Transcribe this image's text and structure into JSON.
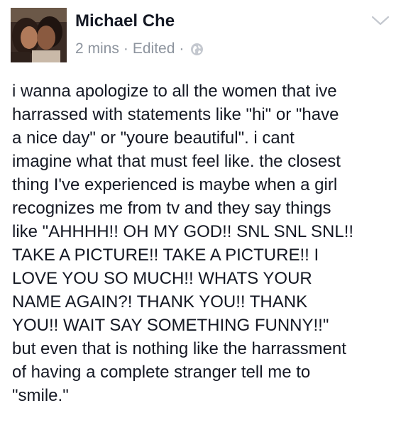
{
  "post": {
    "author": "Michael Che",
    "time": "2 mins",
    "dot1": "·",
    "edited": "Edited",
    "dot2": "·",
    "privacy_icon": "globe-icon",
    "menu_icon": "chevron-down-icon",
    "avatar_icon": "profile-photo",
    "text": "i wanna apologize to all the women that ive\nharrassed with statements like \"hi\" or \"have\na nice day\" or \"youre beautiful\". i cant\nimagine what that must feel like. the closest\nthing I've experienced is maybe when a girl\nrecognizes me from tv and they say things\nlike \"AHHHH!! OH MY GOD!! SNL SNL SNL!!\nTAKE A PICTURE!! TAKE A PICTURE!! I\nLOVE YOU SO MUCH!! WHATS YOUR\nNAME AGAIN?! THANK YOU!! THANK\nYOU!! WAIT SAY SOMETHING FUNNY!!\"\nbut even that is nothing like the harrassment\nof having a complete stranger tell me to\n\"smile.\""
  },
  "colors": {
    "text": "#141823",
    "meta": "#8d949e",
    "background": "#ffffff"
  }
}
